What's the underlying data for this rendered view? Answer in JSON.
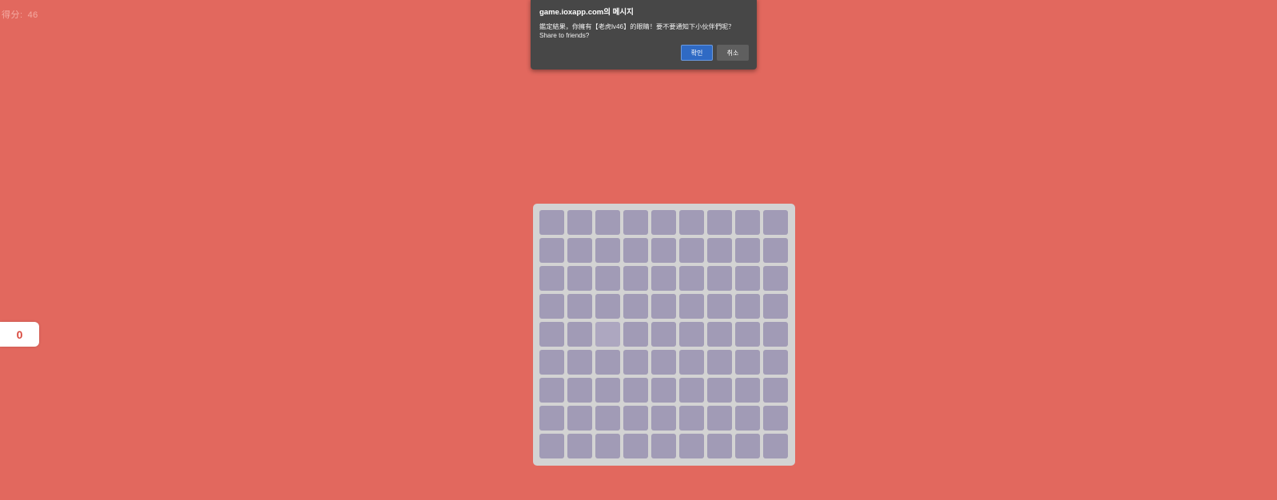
{
  "score": {
    "label": "得分:",
    "value": "46"
  },
  "level": {
    "value": "0"
  },
  "board": {
    "rows": 9,
    "cols": 9,
    "tile_color": "#a19bb6",
    "odd_tile": {
      "row": 4,
      "col": 2,
      "color": "#ada7c0"
    }
  },
  "dialog": {
    "title": "game.ioxapp.com의 메시지",
    "message": "鑑定結果，你擁有【老虎lv46】的眼睛！要不要通知下小伙伴們呢？Share to friends?",
    "ok_label": "확인",
    "cancel_label": "취소"
  },
  "colors": {
    "background": "#e2685e",
    "board_bg": "#d3d3d3",
    "dialog_bg": "#474747",
    "ok_button": "#2f6ac4"
  }
}
